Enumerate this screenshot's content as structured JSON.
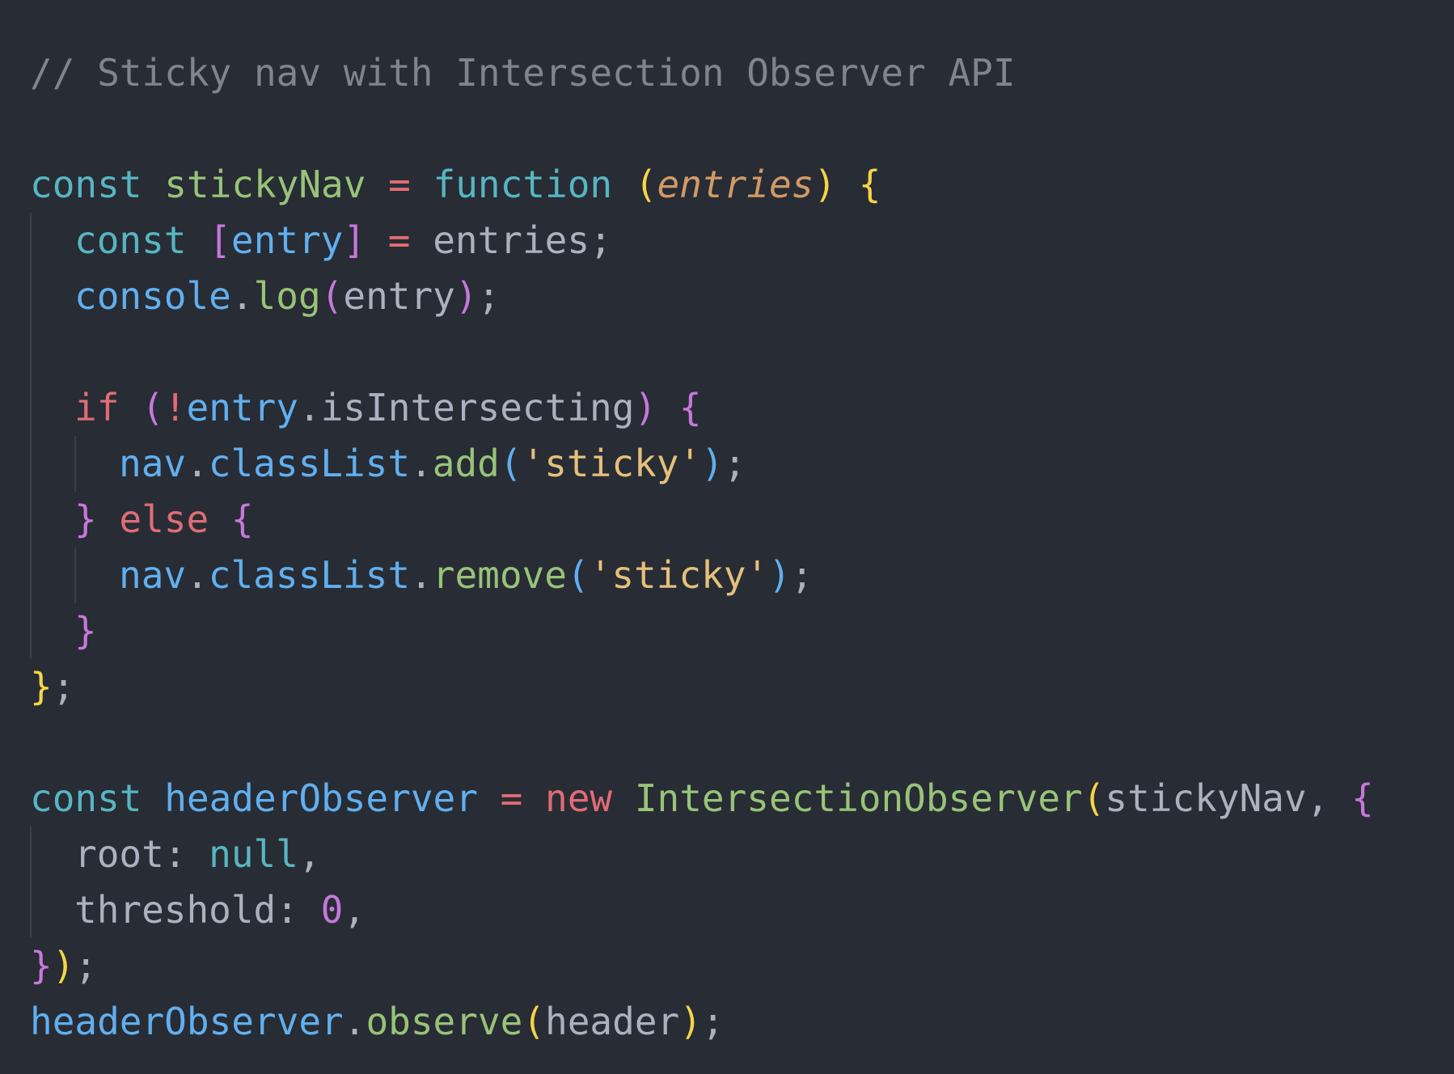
{
  "editor": {
    "language": "javascript",
    "theme_colors": {
      "background": "#282c34",
      "comment": "#7f848e",
      "storage": "#56b6c2",
      "function_name": "#98c379",
      "operator": "#e06c75",
      "parameter": "#d19a66",
      "bracket_level_1": "#f5d547",
      "bracket_level_2": "#c678dd",
      "bracket_level_3": "#61afef",
      "string": "#e5c07b",
      "property": "#61afef",
      "plain": "#abb2bf"
    },
    "lines": [
      {
        "tokens": [
          "// Sticky nav with Intersection Observer API"
        ]
      },
      {
        "tokens": []
      },
      {
        "tokens": [
          "const",
          " ",
          "stickyNav",
          " ",
          "=",
          " ",
          "function",
          " ",
          "(",
          "entries",
          ")",
          " ",
          "{"
        ]
      },
      {
        "tokens": [
          "const",
          " ",
          "[",
          "entry",
          "]",
          " ",
          "=",
          " ",
          "entries;"
        ]
      },
      {
        "tokens": [
          "console",
          ".",
          "log",
          "(",
          "entry",
          ")",
          ";"
        ]
      },
      {
        "tokens": []
      },
      {
        "tokens": [
          "if",
          " ",
          "(",
          "!",
          "entry",
          ".",
          "isIntersecting",
          ")",
          " ",
          "{"
        ]
      },
      {
        "tokens": [
          "nav",
          ".",
          "classList",
          ".",
          "add",
          "(",
          "'sticky'",
          ")",
          ";"
        ]
      },
      {
        "tokens": [
          "}",
          " ",
          "else",
          " ",
          "{"
        ]
      },
      {
        "tokens": [
          "nav",
          ".",
          "classList",
          ".",
          "remove",
          "(",
          "'sticky'",
          ")",
          ";"
        ]
      },
      {
        "tokens": [
          "}"
        ]
      },
      {
        "tokens": [
          "}",
          ";"
        ]
      },
      {
        "tokens": []
      },
      {
        "tokens": [
          "const",
          " ",
          "headerObserver",
          " ",
          "=",
          " ",
          "new",
          " ",
          "IntersectionObserver",
          "(",
          "stickyNav, ",
          "{"
        ]
      },
      {
        "tokens": [
          "root: ",
          "null",
          ","
        ]
      },
      {
        "tokens": [
          "threshold: ",
          "0",
          ","
        ]
      },
      {
        "tokens": [
          "}",
          ")",
          ";"
        ]
      },
      {
        "tokens": [
          "headerObserver",
          ".",
          "observe",
          "(",
          "header",
          ")",
          ";"
        ]
      }
    ]
  }
}
